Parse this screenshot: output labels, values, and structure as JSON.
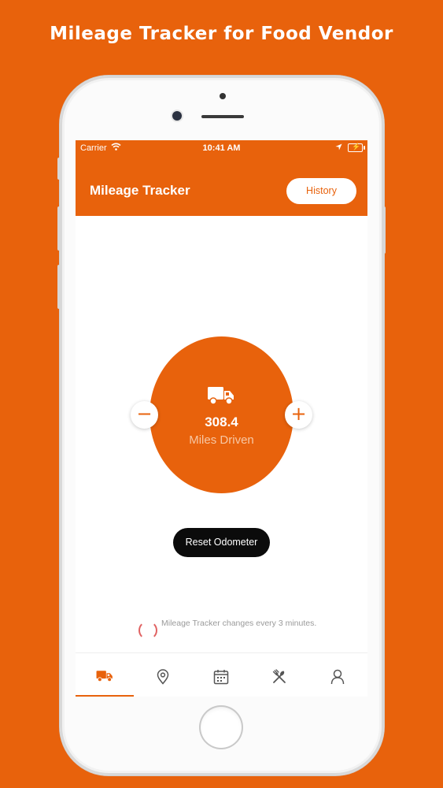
{
  "headline": "Mileage Tracker for Food Vendor",
  "status_bar": {
    "carrier": "Carrier",
    "time": "10:41 AM",
    "wifi_icon": "wifi-icon",
    "location_icon": "location-arrow-icon",
    "battery_icon": "battery-charging-icon"
  },
  "nav": {
    "title": "Mileage Tracker",
    "history_button": "History"
  },
  "odometer": {
    "value": "308.4",
    "label": "Miles Driven",
    "icon": "truck-icon",
    "decrement_label": "−",
    "increment_label": "+"
  },
  "reset_button": "Reset Odometer",
  "note": "Mileage Tracker changes every 3 minutes.",
  "tabs": [
    {
      "icon": "truck-icon",
      "active": true
    },
    {
      "icon": "map-pin-icon",
      "active": false
    },
    {
      "icon": "calendar-icon",
      "active": false
    },
    {
      "icon": "utensils-icon",
      "active": false
    },
    {
      "icon": "user-icon",
      "active": false
    }
  ],
  "colors": {
    "accent": "#e8620c",
    "background": "#e8620c",
    "button_dark": "#0b0b0b",
    "tab_inactive": "#555555"
  }
}
